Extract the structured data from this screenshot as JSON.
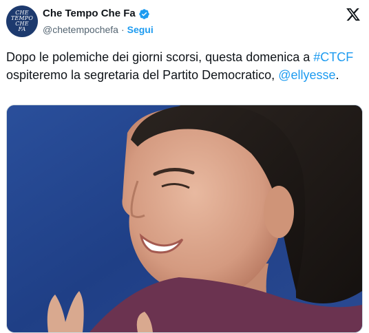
{
  "account": {
    "avatar_text": "CHE\nTEMPO\nCHE\nFA",
    "display_name": "Che Tempo Che Fa",
    "handle": "@chetempochefa",
    "separator": "·",
    "follow_label": "Segui"
  },
  "icons": {
    "verified": "verified-badge-icon",
    "platform": "x-logo-icon"
  },
  "tweet": {
    "text_part1": "Dopo le polemiche dei giorni scorsi, questa domenica a ",
    "hashtag": "#CTCF",
    "text_part2": " ospiteremo la segretaria del Partito Democratico, ",
    "mention": "@ellyesse",
    "text_end": "."
  },
  "media": {
    "description_alt": "photo"
  },
  "colors": {
    "link": "#1d9bf0",
    "verified": "#1d9bf0",
    "background_blue": "#20438a"
  }
}
